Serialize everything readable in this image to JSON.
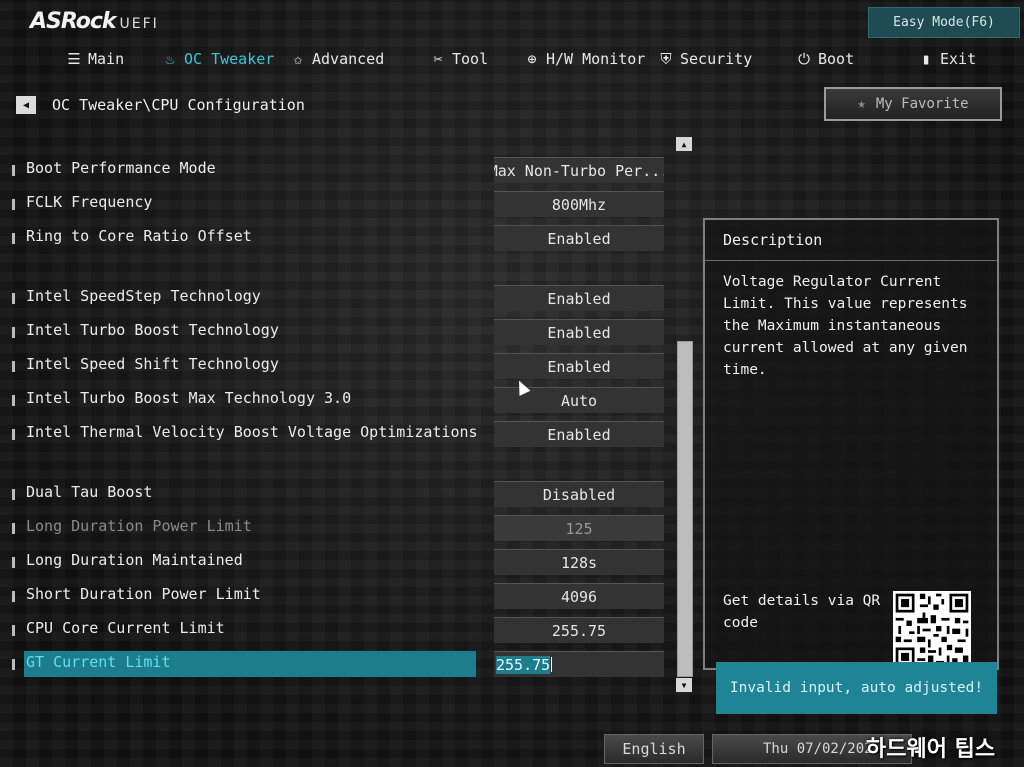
{
  "header": {
    "logo_brand": "ASRock",
    "logo_suffix": "UEFI",
    "easy_mode": "Easy Mode(F6)"
  },
  "nav": [
    {
      "label": "Main",
      "icon": "list-icon",
      "glyph": "☰",
      "active": false
    },
    {
      "label": "OC Tweaker",
      "icon": "flame-icon",
      "glyph": "🜂",
      "active": true
    },
    {
      "label": "Advanced",
      "icon": "star-icon",
      "glyph": "✩",
      "active": false
    },
    {
      "label": "Tool",
      "icon": "tools-icon",
      "glyph": "✂",
      "active": false
    },
    {
      "label": "H/W Monitor",
      "icon": "monitor-icon",
      "glyph": "⊕",
      "active": false
    },
    {
      "label": "Security",
      "icon": "shield-icon",
      "glyph": "⛨",
      "active": false
    },
    {
      "label": "Boot",
      "icon": "power-icon",
      "glyph": "⏻",
      "active": false
    },
    {
      "label": "Exit",
      "icon": "exit-icon",
      "glyph": "▯",
      "active": false
    }
  ],
  "breadcrumb": "OC Tweaker\\CPU Configuration",
  "favorite_label": "My Favorite",
  "settings": [
    {
      "label": "Boot Performance Mode",
      "value": "Max Non-Turbo Per..."
    },
    {
      "label": "FCLK Frequency",
      "value": "800Mhz"
    },
    {
      "label": "Ring to Core Ratio Offset",
      "value": "Enabled"
    },
    {
      "label": "Intel SpeedStep Technology",
      "value": "Enabled"
    },
    {
      "label": "Intel Turbo Boost Technology",
      "value": "Enabled"
    },
    {
      "label": "Intel Speed Shift Technology",
      "value": "Enabled"
    },
    {
      "label": "Intel Turbo Boost Max Technology 3.0",
      "value": "Auto"
    },
    {
      "label": "Intel Thermal Velocity Boost Voltage Optimizations",
      "value": "Enabled"
    },
    {
      "label": "Dual Tau Boost",
      "value": "Disabled"
    },
    {
      "label": "Long Duration Power Limit",
      "value": "125"
    },
    {
      "label": "Long Duration Maintained",
      "value": "128s"
    },
    {
      "label": "Short Duration Power Limit",
      "value": "4096"
    },
    {
      "label": "CPU Core Current Limit",
      "value": "255.75"
    },
    {
      "label": "GT Current Limit",
      "value": "255.75"
    }
  ],
  "description": {
    "title": "Description",
    "text": "Voltage Regulator Current Limit. This value represents the Maximum instantaneous current allowed at any given time.",
    "qr_text": "Get details via QR code"
  },
  "toast": "Invalid input, auto adjusted!",
  "footer": {
    "language": "English",
    "datetime": "Thu 07/02/202"
  },
  "watermark": "하드웨어 팁스"
}
